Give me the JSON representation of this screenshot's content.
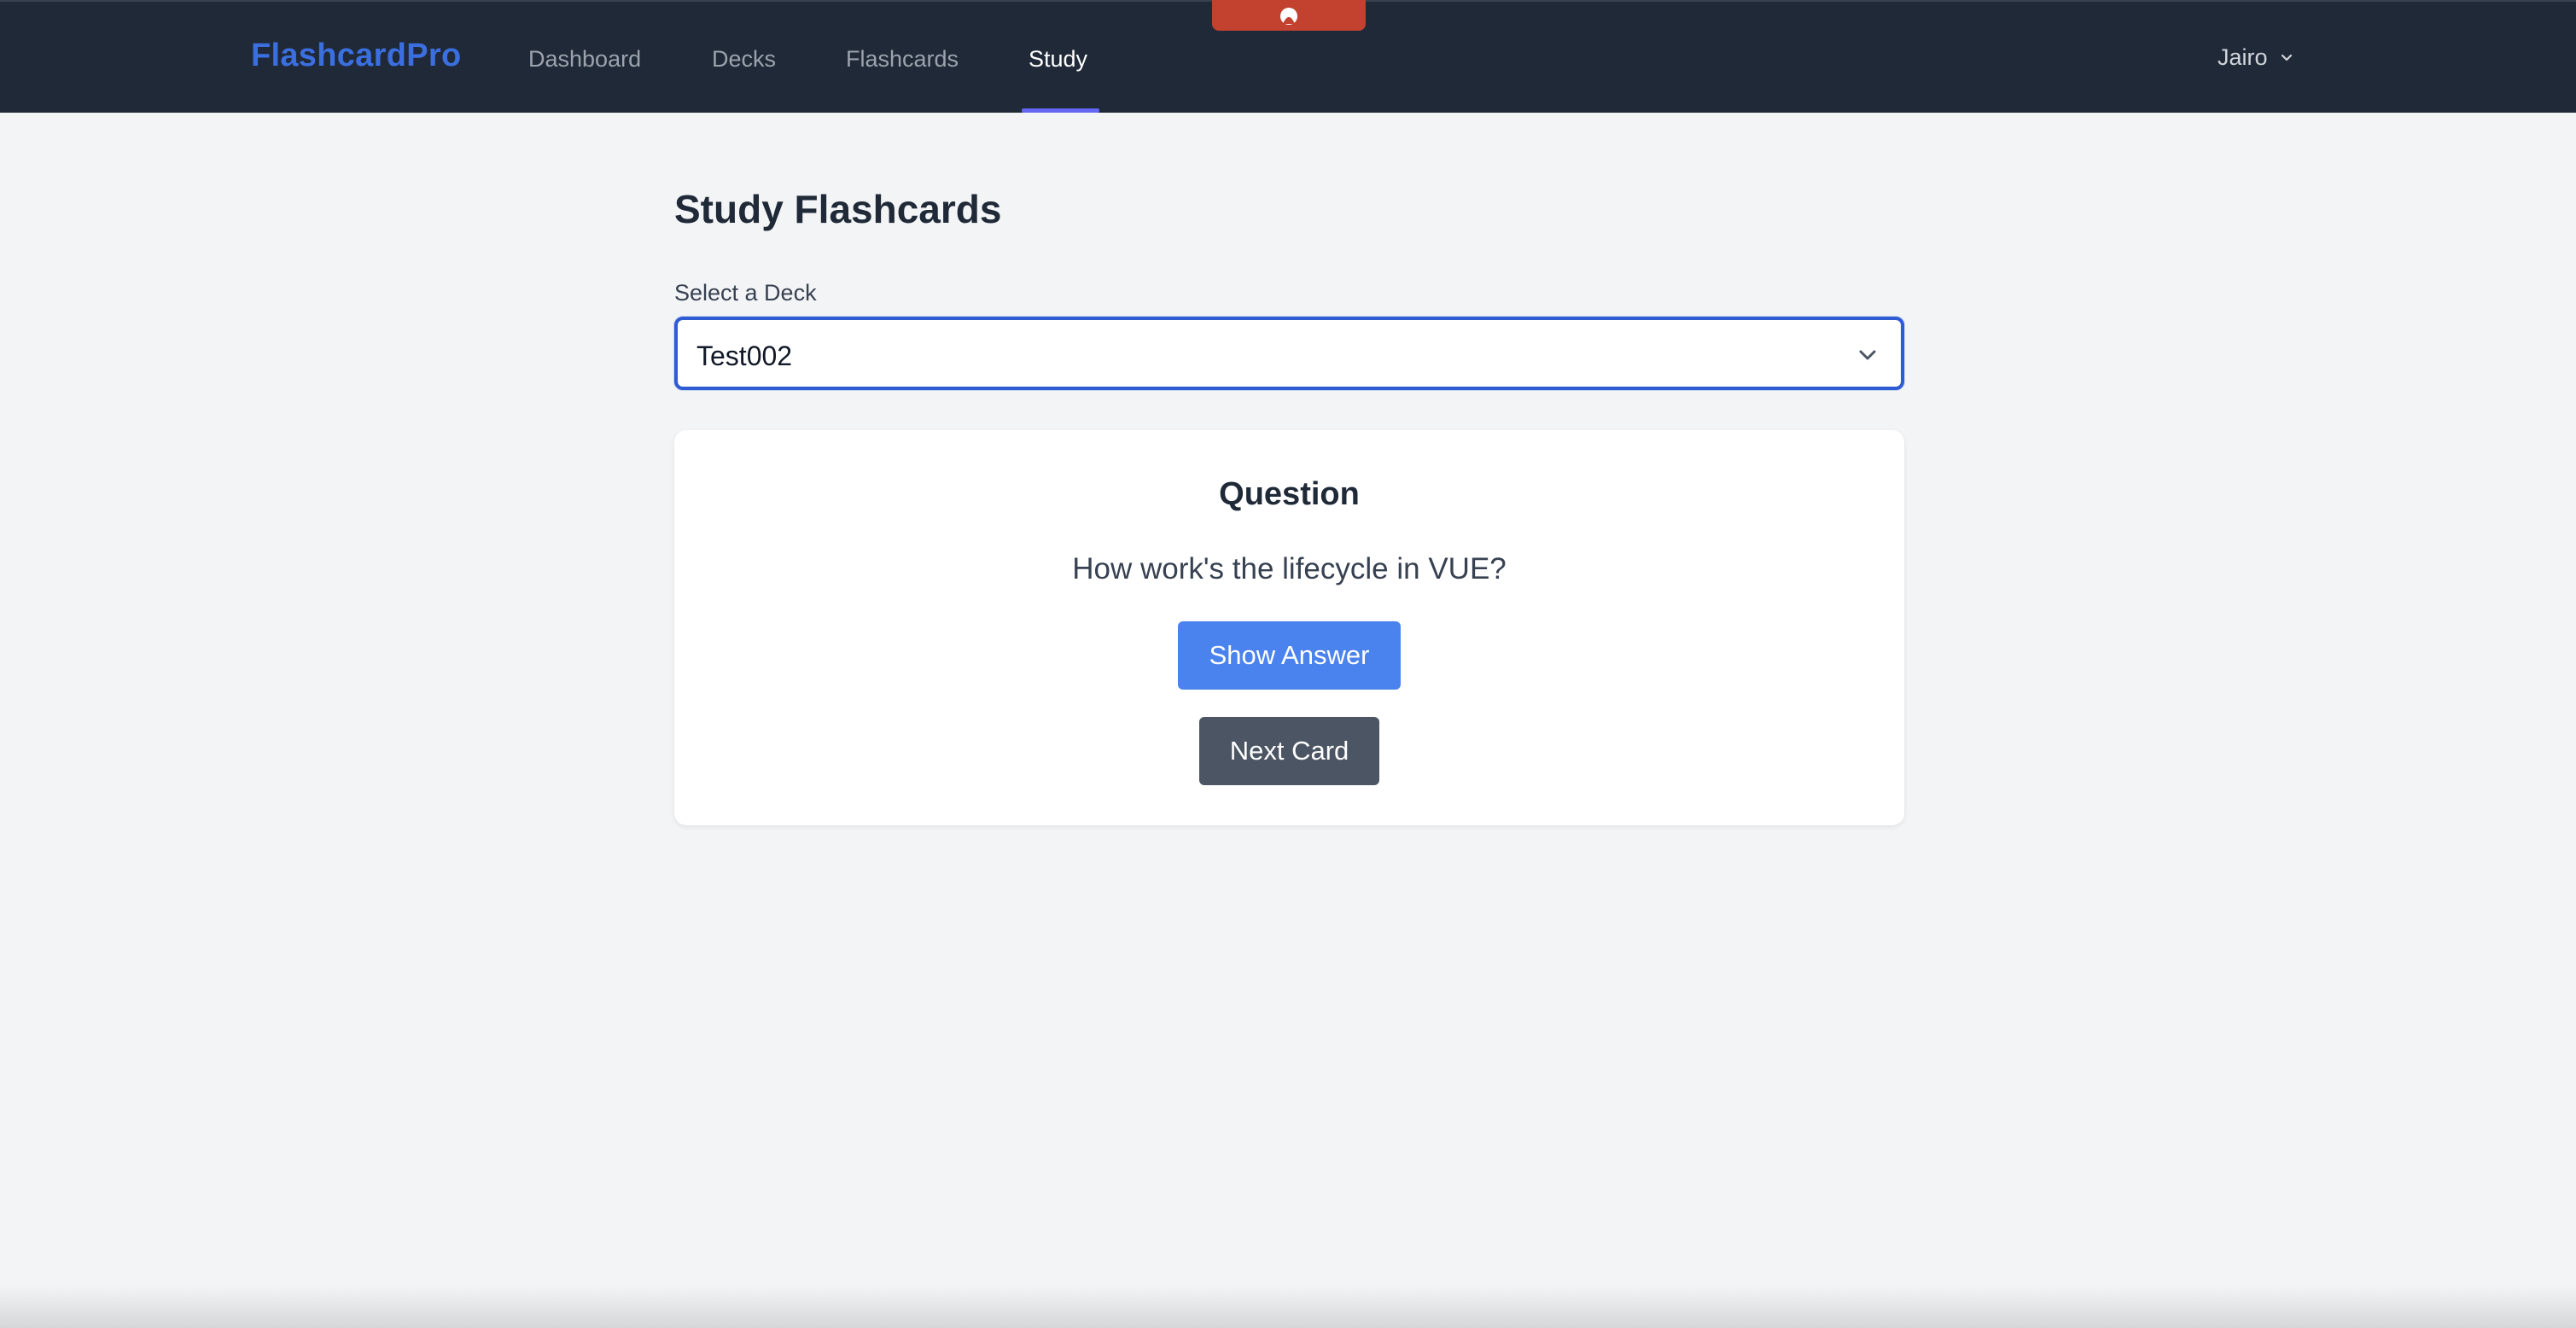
{
  "nav": {
    "brand": "FlashcardPro",
    "links": [
      {
        "label": "Dashboard",
        "active": false
      },
      {
        "label": "Decks",
        "active": false
      },
      {
        "label": "Flashcards",
        "active": false
      },
      {
        "label": "Study",
        "active": true
      }
    ],
    "user": "Jairo",
    "accent_color": "#6366f1",
    "brand_color": "#3b6fe0"
  },
  "page": {
    "title": "Study Flashcards",
    "deck_label": "Select a Deck",
    "selected_deck": "Test002"
  },
  "card": {
    "heading": "Question",
    "question": "How work's the lifecycle in VUE?",
    "show_answer_label": "Show Answer",
    "next_card_label": "Next Card"
  }
}
